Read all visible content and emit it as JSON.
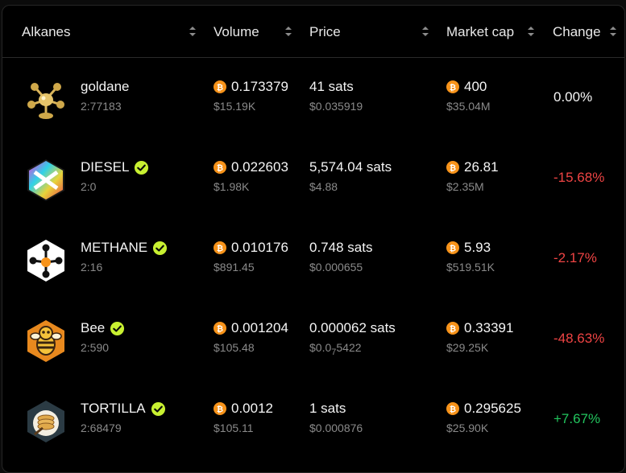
{
  "colors": {
    "positive": "#22c55e",
    "negative": "#ef4444",
    "neutral": "#f5f5f5",
    "verified": "#c8f031",
    "btc": "#f7931a"
  },
  "header": {
    "col_alkanes": "Alkanes",
    "col_volume": "Volume",
    "col_price": "Price",
    "col_market_cap": "Market cap",
    "col_change": "Change"
  },
  "rows": [
    {
      "name": "goldane",
      "id": "2:77183",
      "verified": false,
      "icon": "goldane-logo-icon",
      "volume_btc": "0.173379",
      "volume_usd": "$15.19K",
      "price_sats": "41 sats",
      "price_usd": "$0.035919",
      "mcap_btc": "400",
      "mcap_usd": "$35.04M",
      "change": "0.00%",
      "change_dir": "neutral"
    },
    {
      "name": "DIESEL",
      "id": "2:0",
      "verified": true,
      "icon": "diesel-logo-icon",
      "volume_btc": "0.022603",
      "volume_usd": "$1.98K",
      "price_sats": "5,574.04 sats",
      "price_usd": "$4.88",
      "mcap_btc": "26.81",
      "mcap_usd": "$2.35M",
      "change": "-15.68%",
      "change_dir": "negative"
    },
    {
      "name": "METHANE",
      "id": "2:16",
      "verified": true,
      "icon": "methane-logo-icon",
      "volume_btc": "0.010176",
      "volume_usd": "$891.45",
      "price_sats": "0.748 sats",
      "price_usd": "$0.000655",
      "mcap_btc": "5.93",
      "mcap_usd": "$519.51K",
      "change": "-2.17%",
      "change_dir": "negative"
    },
    {
      "name": "Bee",
      "id": "2:590",
      "verified": true,
      "icon": "bee-logo-icon",
      "volume_btc": "0.001204",
      "volume_usd": "$105.48",
      "price_sats": "0.000062 sats",
      "price_usd_prefix": "$0.0",
      "price_usd_zeros": "7",
      "price_usd_suffix": "5422",
      "mcap_btc": "0.33391",
      "mcap_usd": "$29.25K",
      "change": "-48.63%",
      "change_dir": "negative"
    },
    {
      "name": "TORTILLA",
      "id": "2:68479",
      "verified": true,
      "icon": "tortilla-logo-icon",
      "volume_btc": "0.0012",
      "volume_usd": "$105.11",
      "price_sats": "1 sats",
      "price_usd": "$0.000876",
      "mcap_btc": "0.295625",
      "mcap_usd": "$25.90K",
      "change": "+7.67%",
      "change_dir": "positive"
    }
  ]
}
